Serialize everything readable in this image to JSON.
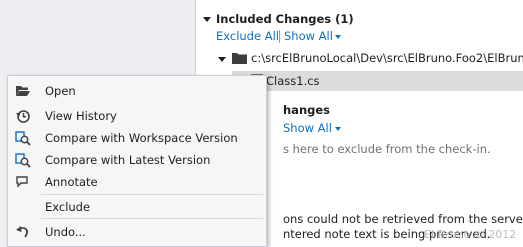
{
  "included": {
    "title": "Included Changes (1)",
    "exclude_all": "Exclude All",
    "show_all": "Show All",
    "path": "c:\\srcElBrunoLocal\\Dev\\src\\ElBruno.Foo2\\ElBrun",
    "file": "Class1.cs"
  },
  "excluded": {
    "title_partial": "hanges",
    "show_all": "Show All",
    "drag_hint_partial": "s here to exclude from the check-in."
  },
  "notes": {
    "line1_partial": "ons could not be retrieved from the server.",
    "line2_partial": "ntered note text is being preserved."
  },
  "context_menu": {
    "items": [
      {
        "label": "Open",
        "icon": "open-folder-icon"
      },
      {
        "label": "View History",
        "icon": "history-icon"
      },
      {
        "label": "Compare with Workspace Version",
        "icon": "compare-icon"
      },
      {
        "label": "Compare with Latest Version",
        "icon": "compare-icon"
      },
      {
        "label": "Annotate",
        "icon": "annotate-icon"
      },
      {
        "label": "Exclude",
        "icon": ""
      },
      {
        "label": "Undo...",
        "icon": "undo-icon"
      }
    ]
  },
  "watermark": "El Bruno © 2012",
  "colors": {
    "link": "#0e70c0",
    "menu_bg": "#f6f6f6",
    "selection": "#dcdcdc",
    "folder": "#3c3c3c"
  }
}
